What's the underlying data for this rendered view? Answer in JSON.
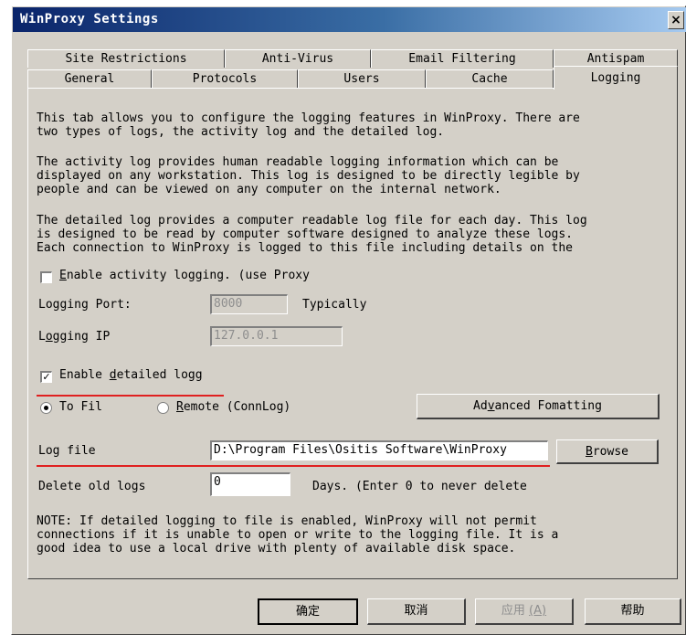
{
  "window": {
    "title": "WinProxy Settings",
    "close_glyph": "×"
  },
  "tabs_row1": [
    "Site Restrictions",
    "Anti-Virus",
    "Email Filtering",
    "Antispam"
  ],
  "tabs_row2": [
    "General",
    "Protocols",
    "Users",
    "Cache",
    "Logging"
  ],
  "active_tab": "Logging",
  "intro": {
    "p1": "This tab allows you to configure the logging features in WinProxy. There are\ntwo types of logs, the activity log and the detailed log.",
    "p2": "The activity log provides human readable logging information which can be\ndisplayed on any workstation. This log is designed to be directly legible by\npeople and can be viewed on any computer on the internal network.",
    "p3": "The detailed log provides a computer readable log file for each day. This log\nis designed to be read by computer software designed to analyze these logs.\nEach connection to WinProxy is logged to this file including details on the"
  },
  "activity": {
    "enable_label_pre": "",
    "enable_label_u": "E",
    "enable_label_post": "nable activity logging. (use Proxy",
    "checked": false,
    "port_label": "Logging Port:",
    "port_value": "8000",
    "port_hint": "Typically",
    "ip_label_pre": "L",
    "ip_label_u": "o",
    "ip_label_post": "gging IP",
    "ip_value": "127.0.0.1"
  },
  "detailed": {
    "enable_label_pre": "Enable ",
    "enable_label_u": "d",
    "enable_label_post": "etailed logg",
    "checked": true,
    "check_glyph": "✓",
    "to_file_label": "To Fil",
    "to_file_selected": true,
    "remote_label_u": "R",
    "remote_label_post": "emote (ConnLog)",
    "remote_selected": false,
    "advanced_pre": "Ad",
    "advanced_u": "v",
    "advanced_post": "anced Fomatting"
  },
  "logfile": {
    "label": "Log file",
    "value": "D:\\Program Files\\Ositis Software\\WinProxy",
    "browse_u": "B",
    "browse_post": "rowse"
  },
  "delete": {
    "label": "Delete old logs",
    "value": "0",
    "suffix": "Days.  (Enter 0 to never delete"
  },
  "note": "NOTE: If detailed logging to file is enabled, WinProxy will not permit\nconnections if it is unable to open or write to the logging file. It is a\ngood idea to use a local drive with plenty of available disk space.",
  "footer": {
    "ok": "确定",
    "cancel": "取消",
    "apply": "应用",
    "apply_key": "(A)",
    "help": "帮助"
  },
  "colors": {
    "annotation_red": "#e02020",
    "titlebar_start": "#0a246a",
    "dialog_bg": "#d4d0c8"
  }
}
